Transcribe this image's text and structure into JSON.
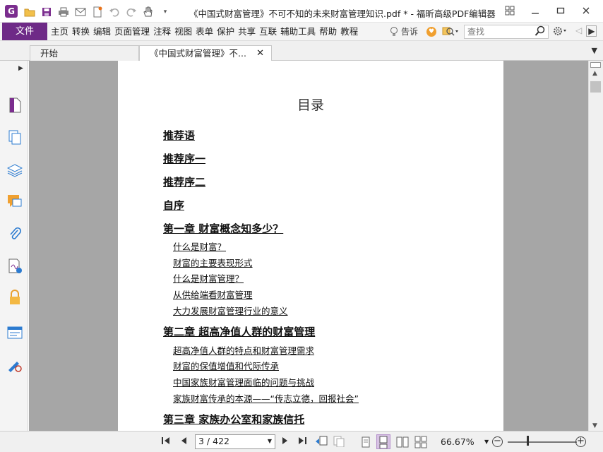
{
  "app": {
    "logo_letter": "G",
    "window_title": "《中国式财富管理》不可不知的未来财富管理知识.pdf * - 福昕高级PDF编辑器"
  },
  "menu": {
    "file": "文件",
    "items": [
      "主页",
      "转换",
      "编辑",
      "页面管理",
      "注释",
      "视图",
      "表单",
      "保护",
      "共享",
      "互联",
      "辅助工具",
      "帮助",
      "教程"
    ],
    "tell": "告诉",
    "search_placeholder": "查找"
  },
  "tabs": [
    {
      "label": "开始"
    },
    {
      "label": "《中国式财富管理》不...",
      "close": "✕"
    }
  ],
  "left_panel": {
    "icons": [
      "page-thumbnail-icon",
      "pages-icon",
      "layers-icon",
      "comments-icon",
      "attachments-icon",
      "signature-icon",
      "lock-icon",
      "form-fields-icon",
      "certify-icon"
    ]
  },
  "document": {
    "title": "目录",
    "entries": [
      {
        "text": "推荐语",
        "level": 1
      },
      {
        "text": "推荐序一",
        "level": 1
      },
      {
        "text": "推荐序二",
        "level": 1
      },
      {
        "text": "自序",
        "level": 1
      },
      {
        "text": "第一章  财富概念知多少？",
        "level": 1
      },
      {
        "text": "什么是财富？",
        "level": 2
      },
      {
        "text": "财富的主要表现形式",
        "level": 2
      },
      {
        "text": "什么是财富管理？",
        "level": 2
      },
      {
        "text": "从供给端看财富管理",
        "level": 2
      },
      {
        "text": "大力发展财富管理行业的意义",
        "level": 2
      },
      {
        "text": "第二章  超高净值人群的财富管理",
        "level": 1
      },
      {
        "text": "超高净值人群的特点和财富管理需求",
        "level": 2
      },
      {
        "text": "财富的保值增值和代际传承",
        "level": 2
      },
      {
        "text": "中国家族财富管理面临的问题与挑战",
        "level": 2
      },
      {
        "text": "家族财富传承的本源——“传志立德，回报社会”",
        "level": 2
      },
      {
        "text": "第三章  家族办公室和家族信托",
        "level": 1
      }
    ]
  },
  "status": {
    "page_indicator": "3 / 422",
    "zoom": "66.67%",
    "zoom_slider_level": 0.29
  }
}
